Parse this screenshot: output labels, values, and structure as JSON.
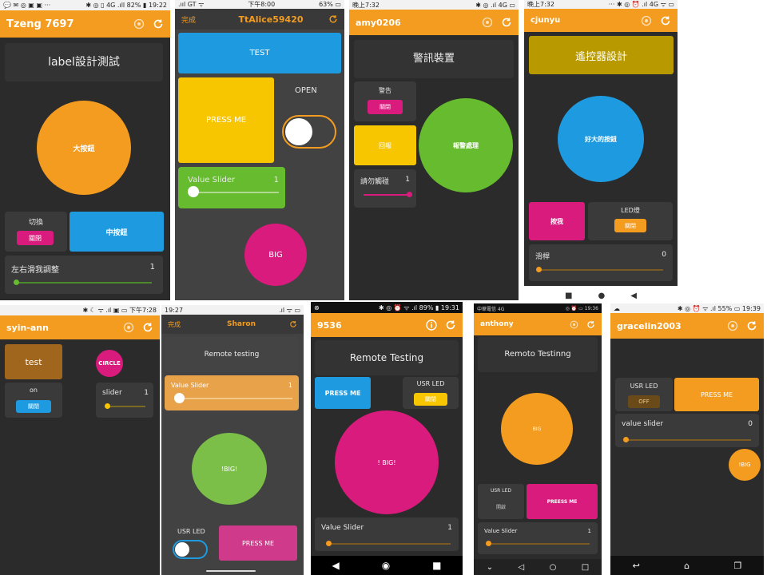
{
  "colors": {
    "orange": "#f39c1f",
    "magenta": "#d81b7c",
    "blue": "#1e9be0",
    "yellow": "#f7c600",
    "green": "#66bb2e",
    "olive": "#b89a00",
    "dark": "#2b2b2b",
    "card": "#3a3a3a"
  },
  "p1": {
    "status_left": "💬 ✉ ◎ ▣ ▣ ···",
    "status_right": "✱ ◎ ▯ 4G .ıll 82% ▮ 19:22",
    "title": "Tzeng 7697",
    "label": "label設計測試",
    "big_btn": "大按鈕",
    "switch_label": "切換",
    "switch_btn": "關閉",
    "mid_btn": "中按鈕",
    "slider_label": "左右滑我調整",
    "slider_value": "1"
  },
  "p2": {
    "status_left": ".ııl GT ᯤ",
    "status_center": "下午8:00",
    "status_right": "63% ▭",
    "done": "完成",
    "title": "TtAlice59420",
    "test_btn": "TEST",
    "press_btn": "PRESS  ME",
    "open_label": "OPEN",
    "slider_label": "Value  Slider",
    "slider_value": "1",
    "big_btn": "BIG"
  },
  "p3": {
    "status_left": "晚上7:32",
    "status_right": "✱ ◎ .ıl 4G ▭",
    "title": "amy0206",
    "label": "警訊裝置",
    "warn_label": "警告",
    "warn_btn": "關閉",
    "back_btn": "回報",
    "alarm_btn": "報警處理",
    "touch_label": "請勿觸碰",
    "touch_value": "1"
  },
  "p4": {
    "status_left": "晚上7:32",
    "status_right": "··· ✱ ◎ ⏰ .ıl 4G ᯤ ▭",
    "title": "cjunyu",
    "label": "遙控器設計",
    "big_btn": "好大的按鈕",
    "press_btn": "按我",
    "led_label": "LED燈",
    "led_btn": "關閉",
    "slider_label": "滑桿",
    "slider_value": "0"
  },
  "p5": {
    "status_right": "✱ ☾ ᯤ .ıl ▣ ▭ 下午7:28",
    "title": "syin-ann",
    "test_btn": "test",
    "circle_btn": "CIRCLE",
    "on_label": "on",
    "on_btn": "關閉",
    "slider_label": "slider",
    "slider_value": "1"
  },
  "p6": {
    "status_left": "19:27",
    "status_right": ".ıl ᯤ ▭",
    "done": "完成",
    "title": "Sharon",
    "label": "Remote testing",
    "slider_label": "Value Slider",
    "slider_value": "1",
    "big_btn": "!BIG!",
    "led_label": "USR LED",
    "press_btn": "PRESS ME"
  },
  "p7": {
    "status_left": "⊗",
    "status_right": "✱ ◎ ⏰ ᯤ .ıl 89% ▮ 19:31",
    "title": "9536",
    "label": "Remote Testing",
    "press_btn": "PRESS ME",
    "led_label": "USR  LED",
    "led_btn": "關閉",
    "big_btn": "! BIG!",
    "slider_label": "Value  Slider",
    "slider_value": "1"
  },
  "p8": {
    "status_left": "中華電信 4G",
    "status_right": "◎ ⏰ ▭ 19:36",
    "title": "anthony",
    "label": "Remoto Testinng",
    "big_btn": "BIG",
    "led_label": "USR LED",
    "led_btn": "開啟",
    "press_btn": "PREESS ME",
    "slider_label": "Value Slider",
    "slider_value": "1"
  },
  "p9": {
    "status_left": "☁",
    "status_right": "✱ ◎ ⏰ ᯤ .ıl 55% ▭ 19:39",
    "title": "gracelin2003",
    "led_label": "USR LED",
    "led_btn": "OFF",
    "press_btn": "PRESS ME",
    "slider_label": "value slider",
    "slider_value": "0",
    "big_btn": "!BIG"
  },
  "nav": {
    "square": "■",
    "circle": "●",
    "back": "◀"
  }
}
